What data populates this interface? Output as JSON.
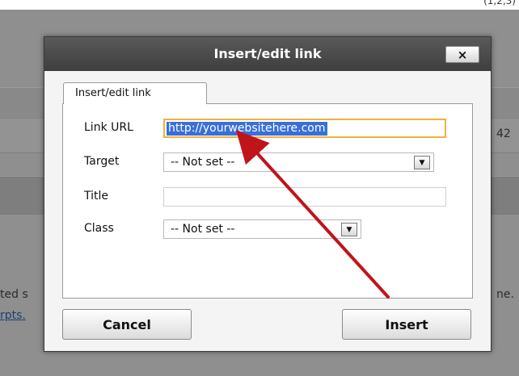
{
  "background": {
    "top_right_text": "(1,2,3)",
    "row_number": "42",
    "left_text_1": "ted s",
    "left_link_2": "rpts.",
    "right_text_1": "ne."
  },
  "dialog": {
    "title": "Insert/edit link",
    "close_label": "×",
    "tab_label": "Insert/edit link",
    "fields": {
      "link_url_label": "Link URL",
      "link_url_value": "http://yourwebsitehere.com",
      "target_label": "Target",
      "target_value": "-- Not set --",
      "title_label": "Title",
      "title_value": "",
      "class_label": "Class",
      "class_value": "-- Not set --"
    },
    "buttons": {
      "cancel": "Cancel",
      "insert": "Insert"
    }
  },
  "annotation": {
    "arrow_color": "#c0141b"
  }
}
